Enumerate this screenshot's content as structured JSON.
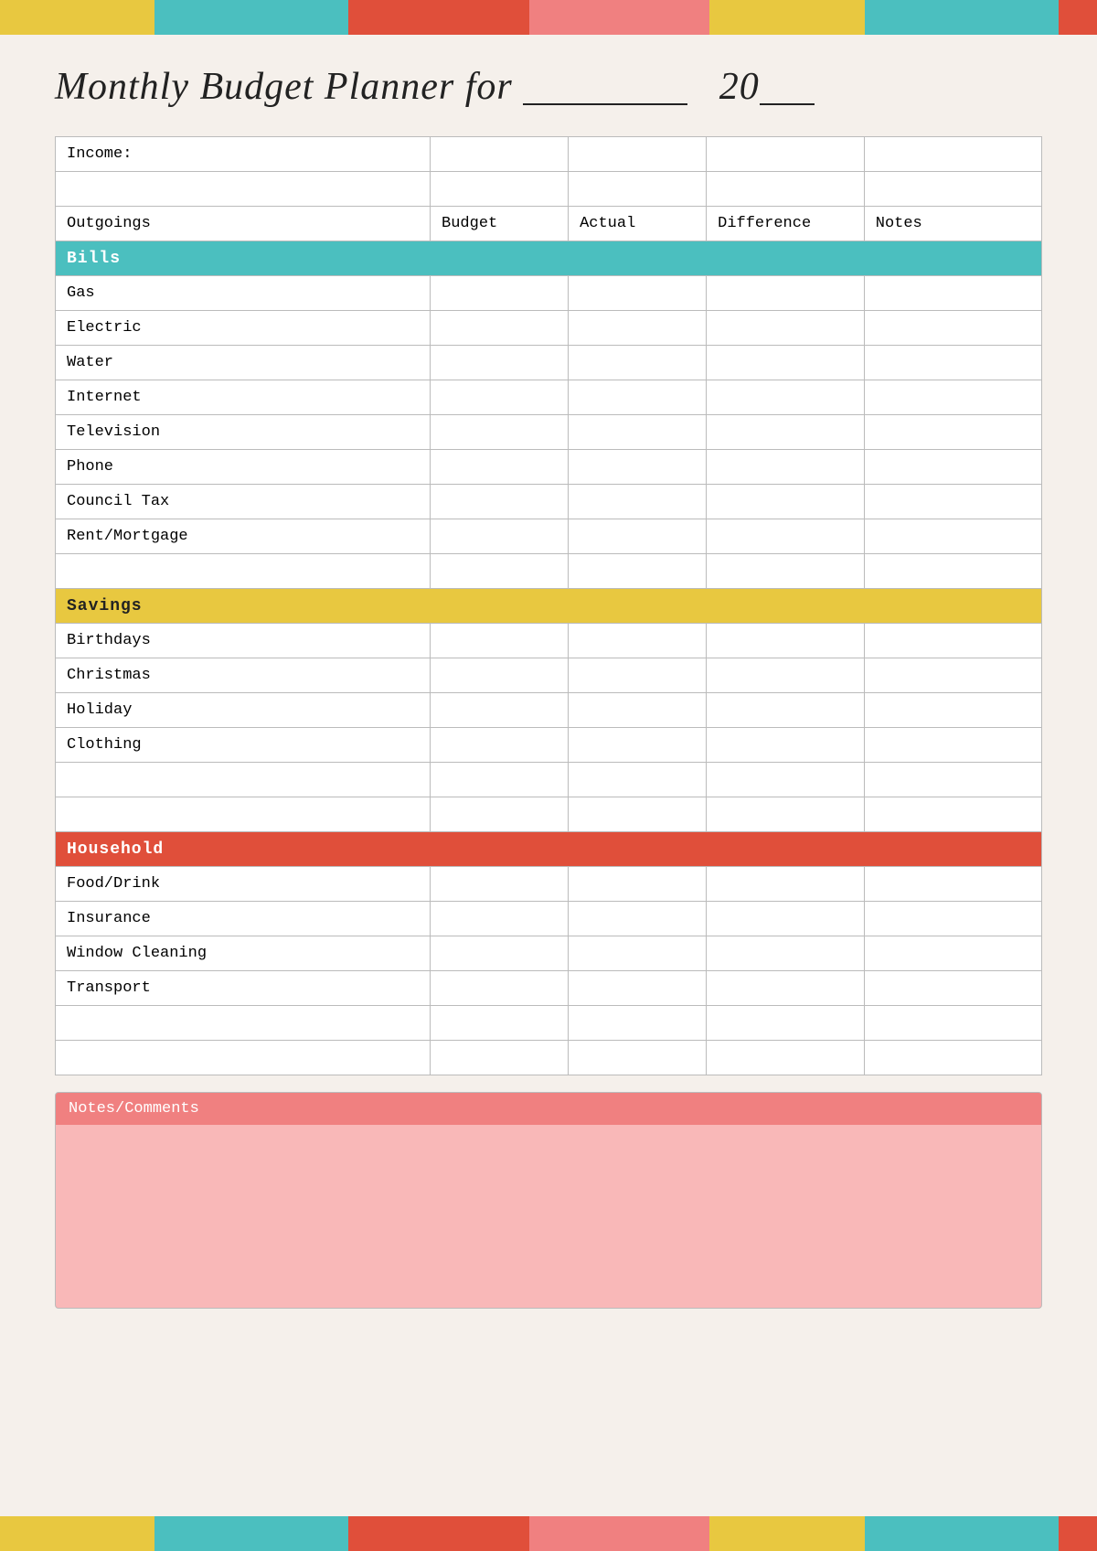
{
  "colorBarsTop": [
    {
      "color": "#e8c840",
      "flex": 1.2
    },
    {
      "color": "#4bbfbf",
      "flex": 1.5
    },
    {
      "color": "#e04f3a",
      "flex": 1.4
    },
    {
      "color": "#f08080",
      "flex": 1.4
    },
    {
      "color": "#e8c840",
      "flex": 1.2
    },
    {
      "color": "#4bbfbf",
      "flex": 1.5
    },
    {
      "color": "#e04f3a",
      "flex": 0.3
    }
  ],
  "title": {
    "prefix": "Monthly Budget Planner for",
    "line": "_________",
    "year_prefix": "20",
    "year_line": "__"
  },
  "table": {
    "income_label": "Income:",
    "headers": {
      "outgoings": "Outgoings",
      "budget": "Budget",
      "actual": "Actual",
      "difference": "Difference",
      "notes": "Notes"
    },
    "sections": [
      {
        "name": "Bills",
        "color": "section-bills",
        "items": [
          "Gas",
          "Electric",
          "Water",
          "Internet",
          "Television",
          "Phone",
          "Council Tax",
          "Rent/Mortgage"
        ]
      },
      {
        "name": "Savings",
        "color": "section-savings",
        "items": [
          "Birthdays",
          "Christmas",
          "Holiday",
          "Clothing",
          "",
          ""
        ]
      },
      {
        "name": "Household",
        "color": "section-household",
        "items": [
          "Food/Drink",
          "Insurance",
          "Window Cleaning",
          "Transport",
          "",
          ""
        ]
      }
    ]
  },
  "notes": {
    "header": "Notes/Comments"
  }
}
